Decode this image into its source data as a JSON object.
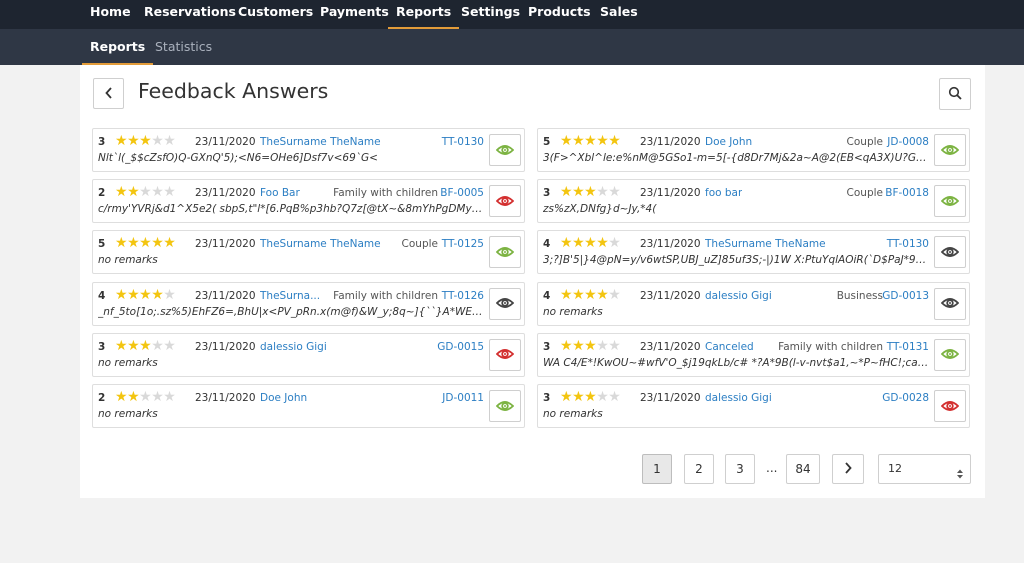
{
  "nav": {
    "items": [
      {
        "label": "Home"
      },
      {
        "label": "Reservations"
      },
      {
        "label": "Customers"
      },
      {
        "label": "Payments"
      },
      {
        "label": "Reports"
      },
      {
        "label": "Settings"
      },
      {
        "label": "Products"
      },
      {
        "label": "Sales"
      }
    ],
    "active": "Reports"
  },
  "subnav": {
    "items": [
      {
        "label": "Reports"
      },
      {
        "label": "Statistics"
      }
    ],
    "active": "Reports"
  },
  "header": {
    "title": "Feedback Answers",
    "back_icon": "chevron-left-icon",
    "search_icon": "search-icon"
  },
  "colors": {
    "eye_green": "#7cb342",
    "eye_red": "#d32f2f",
    "eye_gray": "#444444",
    "star_on": "#f3c510",
    "star_off": "#d9d9d9",
    "link": "#2b7ec3",
    "accent": "#e39c39"
  },
  "feedback": [
    {
      "rating": "3",
      "stars": 3,
      "date": "23/11/2020",
      "customer": "TheSurname TheName",
      "category": "",
      "code": "TT-0130",
      "remarks": "Nlt`l(_$$cZsfO)Q-GXnQ'5);<N6=OHe6]Dsf7v<69`G<",
      "eye": "green"
    },
    {
      "rating": "5",
      "stars": 5,
      "date": "23/11/2020",
      "customer": "Doe John",
      "category": "Couple",
      "code": "JD-0008",
      "remarks": "3(F>^Xbl^le:e%nM@5GSo1-m=5[-{d8Dr7Mj&2a~A@2(EB<qA3X)U?GjPDnTY?...",
      "eye": "green"
    },
    {
      "rating": "2",
      "stars": 2,
      "date": "23/11/2020",
      "customer": "Foo Bar",
      "category": "Family with children",
      "code": "BF-0005",
      "remarks": "c/rmy'YVRj&d1^X5e2( sbpS,t\"l*[6.PqB%p3hb?Q7z[@tX~&8mYhPgDMy6H>-F...",
      "eye": "red"
    },
    {
      "rating": "3",
      "stars": 3,
      "date": "23/11/2020",
      "customer": "foo bar",
      "category": "Couple",
      "code": "BF-0018",
      "remarks": "zs%zX,DNfg}d~Jy,*4(",
      "eye": "green"
    },
    {
      "rating": "5",
      "stars": 5,
      "date": "23/11/2020",
      "customer": "TheSurname TheName",
      "category": "Couple",
      "code": "TT-0125",
      "remarks": "no remarks",
      "eye": "green"
    },
    {
      "rating": "4",
      "stars": 4,
      "date": "23/11/2020",
      "customer": "TheSurname TheName",
      "category": "",
      "code": "TT-0130",
      "remarks": "3;?]B'5|}4@pN=y/v6wtSP,UBJ_uZ]85uf3S;-|)1W X:PtuYqlAOiR(`D$PaJ*9fEpm...",
      "eye": "gray"
    },
    {
      "rating": "4",
      "stars": 4,
      "date": "23/11/2020",
      "customer": "TheSurna...",
      "category": "Family with children",
      "code": "TT-0126",
      "remarks": "_nf_5to[1o;.sz%5)EhFZ6=,BhU|x<PV_pRn.x(m@f)&W_y;8q~]{``}A*WED`]Z5F...",
      "eye": "gray"
    },
    {
      "rating": "4",
      "stars": 4,
      "date": "23/11/2020",
      "customer": "dalessio Gigi",
      "category": "Business",
      "code": "GD-0013",
      "remarks": "no remarks",
      "eye": "gray"
    },
    {
      "rating": "3",
      "stars": 3,
      "date": "23/11/2020",
      "customer": "dalessio Gigi",
      "category": "",
      "code": "GD-0015",
      "remarks": "no remarks",
      "eye": "red"
    },
    {
      "rating": "3",
      "stars": 3,
      "date": "23/11/2020",
      "customer": "Canceled",
      "category": "Family with children",
      "code": "TT-0131",
      "remarks": "WA C4/E*!KwOU~#wfV'O_$j19qkLb/c# *?A*9B(l-v-nvt$a1,~*P~fHC!;ca$QP_?...",
      "eye": "green"
    },
    {
      "rating": "2",
      "stars": 2,
      "date": "23/11/2020",
      "customer": "Doe John",
      "category": "",
      "code": "JD-0011",
      "remarks": "no remarks",
      "eye": "green"
    },
    {
      "rating": "3",
      "stars": 3,
      "date": "23/11/2020",
      "customer": "dalessio Gigi",
      "category": "",
      "code": "GD-0028",
      "remarks": "no remarks",
      "eye": "red"
    }
  ],
  "pagination": {
    "pages": [
      "1",
      "2",
      "3"
    ],
    "ellipsis": "...",
    "last": "84",
    "current": "1",
    "next_icon": "chevron-right-icon"
  },
  "page_size": {
    "value": "12"
  }
}
